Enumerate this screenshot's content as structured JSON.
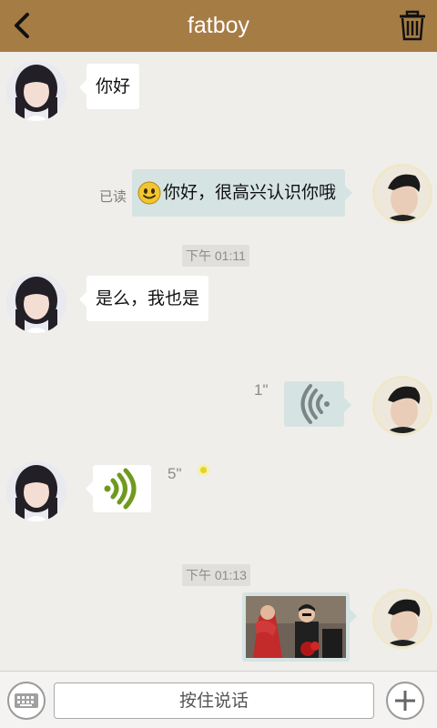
{
  "header": {
    "title": "fatboy",
    "back_icon": "chevron-left-icon",
    "trash_icon": "trash-icon",
    "background": "#a67c45"
  },
  "messages": {
    "m1": {
      "sender": "other",
      "text": "你好"
    },
    "m2": {
      "sender": "me",
      "text": "你好，很高兴认识你哦",
      "emoji": "smiley-emoji",
      "status": "已读"
    },
    "t1": {
      "timestamp": "下午 01:11"
    },
    "m3": {
      "sender": "other",
      "text": "是么，我也是"
    },
    "m4": {
      "sender": "me",
      "type": "voice",
      "duration": "1\""
    },
    "m5": {
      "sender": "other",
      "type": "voice",
      "duration": "5\"",
      "unread": true
    },
    "t2": {
      "timestamp": "下午 01:13"
    },
    "m6": {
      "sender": "me",
      "type": "image"
    }
  },
  "footer": {
    "keyboard_icon": "keyboard-icon",
    "hold_to_talk_label": "按住说话",
    "plus_icon": "plus-icon"
  },
  "colors": {
    "header_bg": "#a67c45",
    "chat_bg": "#efeeea",
    "my_bubble": "#d6e3e3",
    "other_bubble": "#ffffff",
    "voice_green": "#6f9a1e"
  }
}
